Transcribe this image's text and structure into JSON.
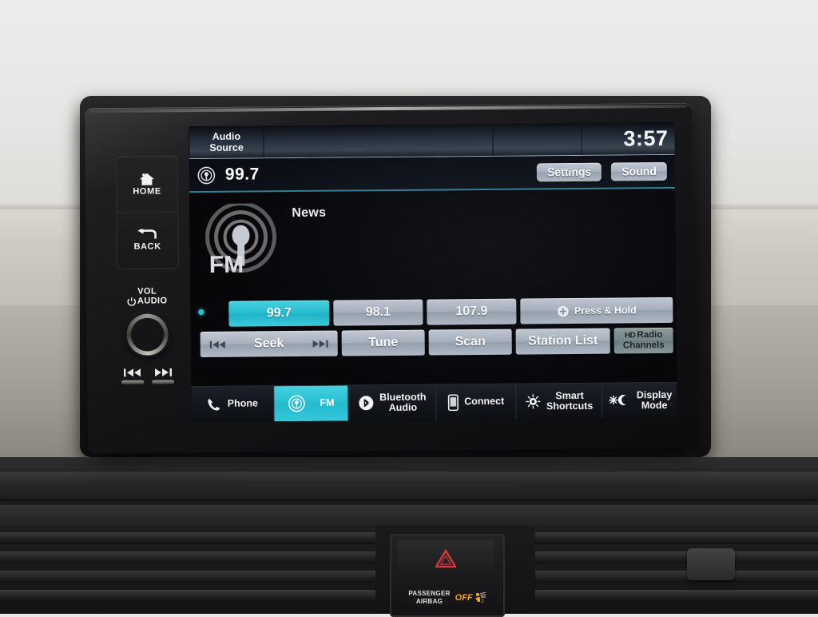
{
  "screen": {
    "status_bar": {
      "audio_source_line1": "Audio",
      "audio_source_line2": "Source",
      "time": "3:57"
    },
    "source_bar": {
      "source_icon": "fm-radio-icon",
      "frequency": "99.7",
      "settings_label": "Settings",
      "sound_label": "Sound"
    },
    "now_playing": {
      "logo_text": "FM",
      "genre": "News"
    },
    "presets": [
      {
        "label": "99.7",
        "active": true
      },
      {
        "label": "98.1",
        "active": false
      },
      {
        "label": "107.9",
        "active": false
      }
    ],
    "add_preset": {
      "icon": "plus-circle-icon",
      "label": "Press & Hold"
    },
    "controls": {
      "seek_label": "Seek",
      "tune_label": "Tune",
      "scan_label": "Scan",
      "station_list_label": "Station List",
      "hd_badge": "HD",
      "hd_line1": "Radio",
      "hd_line2": "Channels"
    },
    "nav": [
      {
        "icon": "phone-icon",
        "label": "Phone",
        "label2": "",
        "active": false
      },
      {
        "icon": "fm-radio-icon",
        "label": "FM",
        "label2": "",
        "active": true
      },
      {
        "icon": "bluetooth-icon",
        "label": "Bluetooth",
        "label2": "Audio",
        "active": false
      },
      {
        "icon": "smartphone-icon",
        "label": "Connect",
        "label2": "",
        "active": false
      },
      {
        "icon": "gear-sun-icon",
        "label": "Smart",
        "label2": "Shortcuts",
        "active": false
      },
      {
        "icon": "sun-moon-icon",
        "label": "Display",
        "label2": "Mode",
        "active": false
      }
    ]
  },
  "hardware": {
    "home_label": "HOME",
    "back_label": "BACK",
    "vol_label": "VOL",
    "audio_label": "AUDIO",
    "prev_icon": "skip-previous-icon",
    "next_icon": "skip-next-icon"
  },
  "dashboard": {
    "hazard_icon": "hazard-triangle-icon",
    "airbag_line1": "PASSENGER",
    "airbag_line2": "AIRBAG",
    "airbag_off": "OFF",
    "airbag_icon": "passenger-airbag-off-icon"
  },
  "colors": {
    "accent_teal": "#27bed1",
    "button_gray": "#a7b0bd",
    "screen_black": "#07070a",
    "status_blue": "#39434f",
    "airbag_amber": "#f0a51e"
  }
}
